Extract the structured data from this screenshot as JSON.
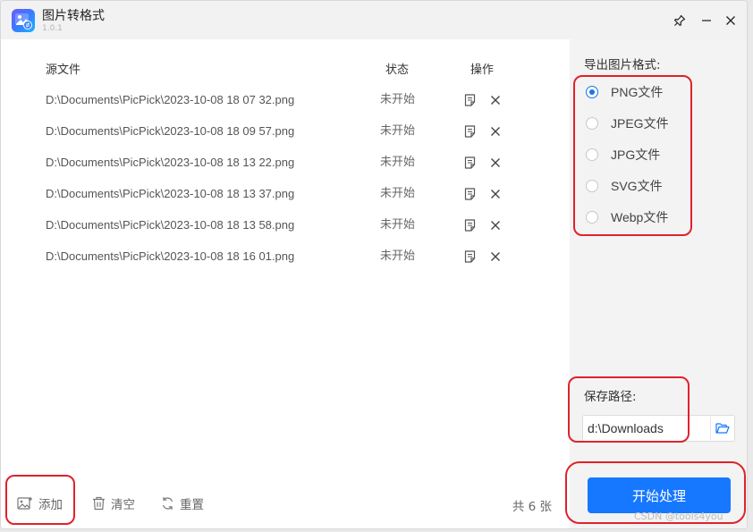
{
  "app": {
    "title": "图片转格式",
    "version": "1.0.1"
  },
  "titlebar": {
    "icons": [
      "pin-icon",
      "minimize-icon",
      "close-icon"
    ]
  },
  "table": {
    "headers": {
      "source": "源文件",
      "status": "状态",
      "action": "操作"
    },
    "rows": [
      {
        "path": "D:\\Documents\\PicPick\\2023-10-08 18 07 32.png",
        "status": "未开始"
      },
      {
        "path": "D:\\Documents\\PicPick\\2023-10-08 18 09 57.png",
        "status": "未开始"
      },
      {
        "path": "D:\\Documents\\PicPick\\2023-10-08 18 13 22.png",
        "status": "未开始"
      },
      {
        "path": "D:\\Documents\\PicPick\\2023-10-08 18 13 37.png",
        "status": "未开始"
      },
      {
        "path": "D:\\Documents\\PicPick\\2023-10-08 18 13 58.png",
        "status": "未开始"
      },
      {
        "path": "D:\\Documents\\PicPick\\2023-10-08 18 16 01.png",
        "status": "未开始"
      }
    ]
  },
  "footer": {
    "add_label": "添加",
    "clear_label": "清空",
    "reset_label": "重置",
    "count_label": "共 6 张"
  },
  "side": {
    "format_label": "导出图片格式:",
    "formats": [
      {
        "label": "PNG文件",
        "checked": true
      },
      {
        "label": "JPEG文件",
        "checked": false
      },
      {
        "label": "JPG文件",
        "checked": false
      },
      {
        "label": "SVG文件",
        "checked": false
      },
      {
        "label": "Webp文件",
        "checked": false
      }
    ],
    "save_path_label": "保存路径:",
    "save_path_value": "d:\\Downloads",
    "start_label": "开始处理"
  },
  "colors": {
    "accent": "#1677ff",
    "radio_accent": "#1a73e8",
    "highlight": "#e0222b"
  },
  "watermark": "CSDN @tools4you"
}
